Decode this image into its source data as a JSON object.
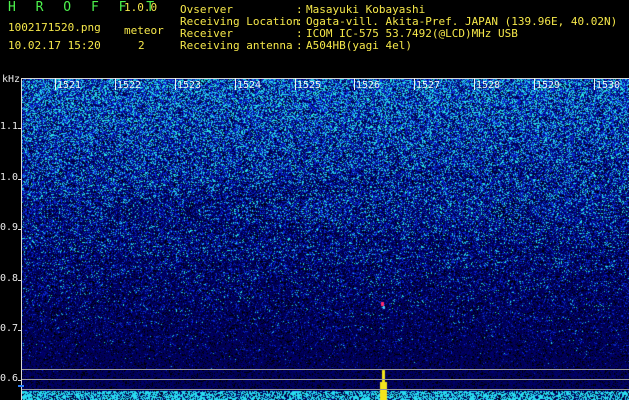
{
  "header": {
    "app_title": "H R O F F T",
    "app_version": "1.0.0",
    "file_name": "1002171520.png",
    "timestamp": "10.02.17 15:20",
    "meteor_label": "meteor",
    "meteor_count": "2"
  },
  "info": [
    {
      "label": "Ovserver",
      "value": "Masayuki Kobayashi"
    },
    {
      "label": "Receiving Location",
      "value": "Ogata-vill. Akita-Pref. JAPAN (139.96E, 40.02N)"
    },
    {
      "label": "Receiver",
      "value": "ICOM IC-575 53.7492(@LCD)MHz USB"
    },
    {
      "label": "Receiving antenna",
      "value": "A504HB(yagi 4el)"
    }
  ],
  "colon": ":",
  "axis": {
    "unit": "kHz",
    "y_ticks": [
      "1.1",
      "1.0",
      "0.9",
      "0.8",
      "0.7",
      "0.6"
    ],
    "x_ticks": [
      "1521",
      "1522",
      "1523",
      "1524",
      "1525",
      "1526",
      "1527",
      "1528",
      "1529",
      "1530"
    ]
  },
  "colors": {
    "background": "#000000",
    "header_green": "#4cf24c",
    "header_yellow": "#f6e84a",
    "noise_low": "#0a1a8c",
    "noise_high": "#33e0ff",
    "signal": "#f4e51c"
  },
  "signals": [
    {
      "name": "meteor-echo-1",
      "minute": 1526.15,
      "khz": 0.75
    },
    {
      "name": "carrier-line",
      "minute": 1526.2,
      "khz": 0.6
    }
  ]
}
